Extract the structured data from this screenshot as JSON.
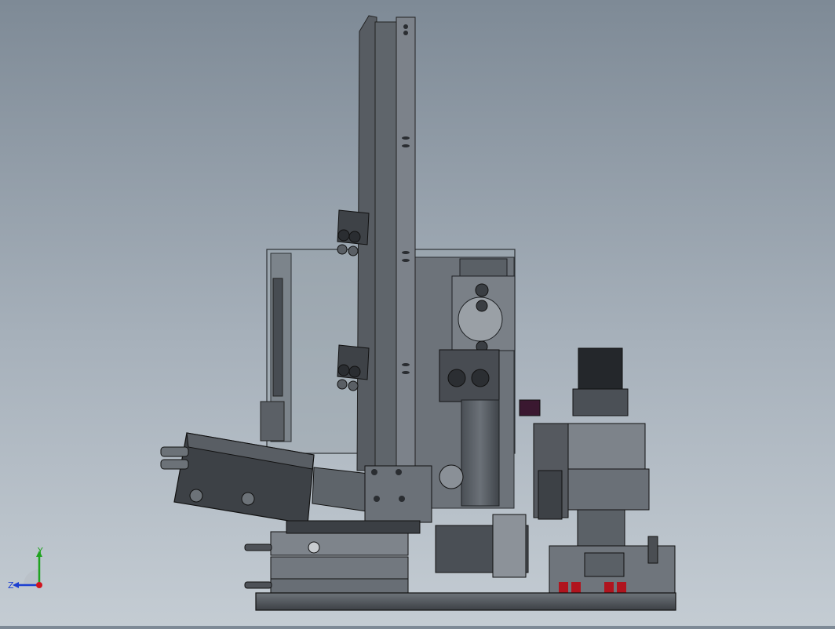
{
  "viewport": {
    "background_top": "#7e8a96",
    "background_bottom": "#c4ccd3",
    "model_dark": "#3b3f44",
    "model_mid": "#5c6168",
    "model_light": "#8a9097",
    "accent_red": "#b0141e",
    "accent_purple": "#3a1830"
  },
  "triad": {
    "x_label": "",
    "y_label": "Y",
    "z_label": "Z",
    "x_color": "#d0141e",
    "y_color": "#1fa31f",
    "z_color": "#1c3fd1"
  }
}
